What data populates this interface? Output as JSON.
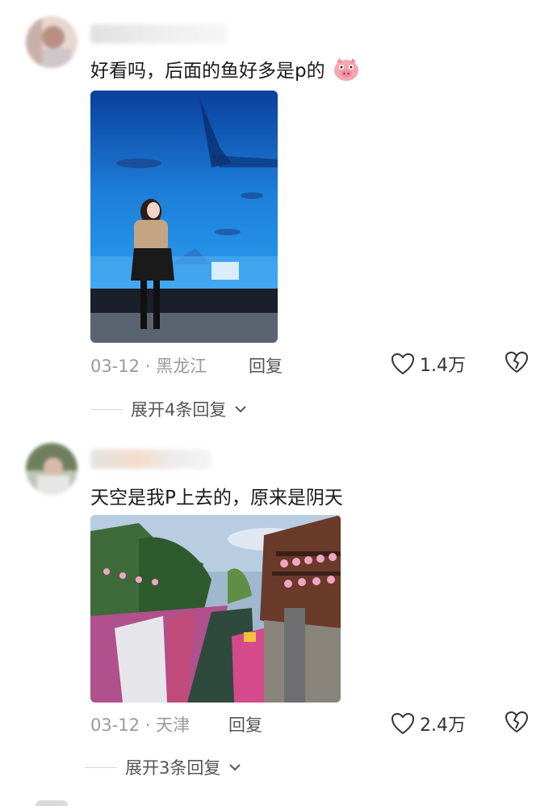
{
  "comments": [
    {
      "text": "好看吗，后面的鱼好多是p的",
      "emoji": "pig-face-icon",
      "date": "03-12",
      "location": "黑龙江",
      "separator": "·",
      "reply_label": "回复",
      "likes": "1.4万",
      "expand_label": "展开4条回复"
    },
    {
      "text": "天空是我P上去的，原来是阴天",
      "date": "03-12",
      "location": "天津",
      "separator": "·",
      "reply_label": "回复",
      "likes": "2.4万",
      "expand_label": "展开3条回复"
    }
  ],
  "colors": {
    "meta": "#9a9a9a",
    "text": "#1a1a1a",
    "divider": "#d9d9d9"
  }
}
